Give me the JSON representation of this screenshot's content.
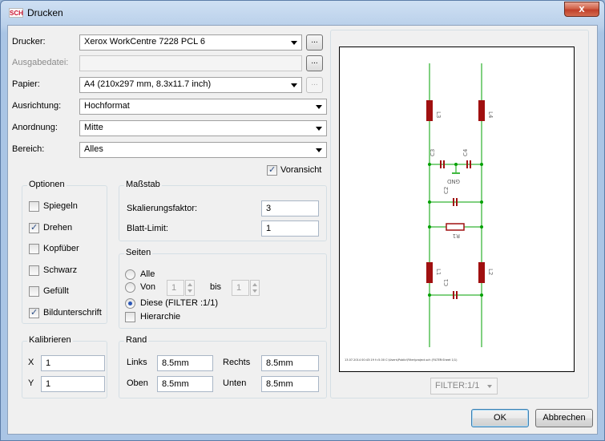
{
  "window": {
    "title": "Drucken",
    "app_icon": "SCH",
    "close_label": "x"
  },
  "printer": {
    "label": "Drucker:",
    "value": "Xerox WorkCentre 7228 PCL 6",
    "button": "..."
  },
  "output_file": {
    "label": "Ausgabedatei:",
    "value": "",
    "button": "..."
  },
  "paper": {
    "label": "Papier:",
    "value": "A4 (210x297 mm, 8.3x11.7 inch)",
    "button": "..."
  },
  "orientation": {
    "label": "Ausrichtung:",
    "value": "Hochformat"
  },
  "arrangement": {
    "label": "Anordnung:",
    "value": "Mitte"
  },
  "range": {
    "label": "Bereich:",
    "value": "Alles"
  },
  "preview_check": {
    "label": "Voransicht",
    "checked": true
  },
  "options": {
    "title": "Optionen",
    "items": [
      {
        "label": "Spiegeln",
        "checked": false
      },
      {
        "label": "Drehen",
        "checked": true
      },
      {
        "label": "Kopfüber",
        "checked": false
      },
      {
        "label": "Schwarz",
        "checked": false
      },
      {
        "label": "Gefüllt",
        "checked": false
      },
      {
        "label": "Bildunterschrift",
        "checked": true
      }
    ]
  },
  "scale": {
    "title": "Maßstab",
    "factor_label": "Skalierungsfaktor:",
    "factor_value": "3",
    "limit_label": "Blatt-Limit:",
    "limit_value": "1"
  },
  "pages": {
    "title": "Seiten",
    "all_label": "Alle",
    "from_label": "Von",
    "from_value": "1",
    "to_label": "bis",
    "to_value": "1",
    "this_label": "Diese (FILTER :1/1)",
    "selected": "this",
    "hierarchy_label": "Hierarchie",
    "hierarchy_checked": false
  },
  "calibrate": {
    "title": "Kalibrieren",
    "x_label": "X",
    "x_value": "1",
    "y_label": "Y",
    "y_value": "1"
  },
  "margin": {
    "title": "Rand",
    "left_label": "Links",
    "left_value": "8.5mm",
    "right_label": "Rechts",
    "right_value": "8.5mm",
    "top_label": "Oben",
    "top_value": "8.5mm",
    "bottom_label": "Unten",
    "bottom_value": "8.5mm"
  },
  "preview": {
    "sheet_select": "FILTER:1/1",
    "caption": "13.07.2014 00:43:19 f=5.00 C:\\Users\\Public\\Filter\\project.sch (FILTER:Sheet 1/1)",
    "parts": [
      "L3",
      "L4",
      "C3",
      "C4",
      "GND",
      "C2",
      "R1",
      "L1",
      "L2",
      "C1"
    ],
    "colors": {
      "wire": "#00a000",
      "part": "#a01010",
      "label": "#606060"
    }
  },
  "buttons": {
    "ok": "OK",
    "cancel": "Abbrechen"
  }
}
